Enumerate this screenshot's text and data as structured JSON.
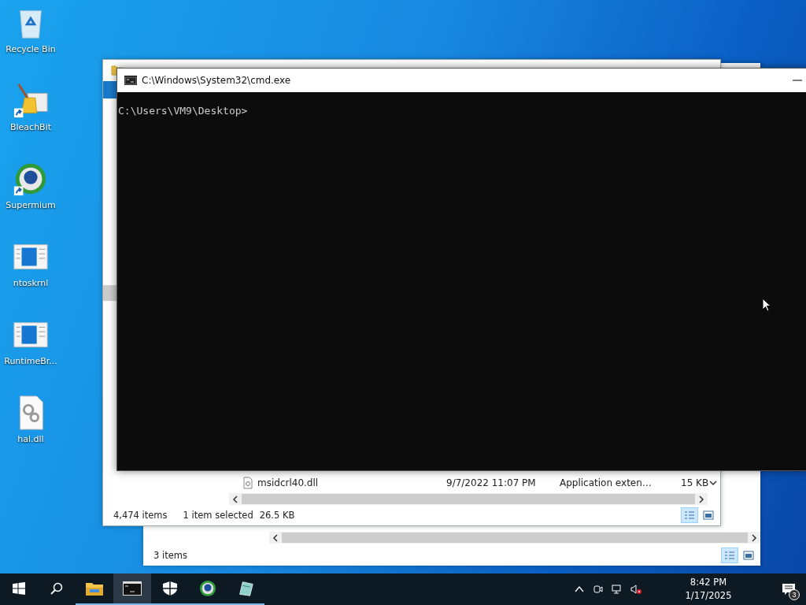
{
  "desktop_icons": [
    {
      "label": "Recycle Bin",
      "kind": "recycle",
      "shortcut": false
    },
    {
      "label": "BleachBit",
      "kind": "broom",
      "shortcut": true
    },
    {
      "label": "Supermium",
      "kind": "browser",
      "shortcut": true
    },
    {
      "label": "ntoskrnl",
      "kind": "window",
      "shortcut": false
    },
    {
      "label": "RuntimeBr...",
      "kind": "window",
      "shortcut": false
    },
    {
      "label": "hal.dll",
      "kind": "gears",
      "shortcut": false
    }
  ],
  "back_explorer": {
    "status": "3 items",
    "views": [
      {
        "kind": "details",
        "selected": true
      },
      {
        "kind": "preview",
        "selected": false
      }
    ]
  },
  "front_explorer": {
    "files": [
      {
        "name": "msidcrl40.dll",
        "date": "9/7/2022 11:07 PM",
        "type": "Application exten…",
        "size": "15 KB"
      }
    ],
    "status": {
      "count": "4,474 items",
      "selection": "1 item selected",
      "size": "26.5 KB"
    },
    "views": [
      {
        "kind": "details",
        "selected": true
      },
      {
        "kind": "preview",
        "selected": false
      }
    ]
  },
  "cmd": {
    "title": "C:\\Windows\\System32\\cmd.exe",
    "lines": [
      "C:\\Users\\VM9\\Desktop>"
    ]
  },
  "taskbar": {
    "apps": [
      {
        "kind": "explorer",
        "open": true,
        "active": false
      },
      {
        "kind": "cmd",
        "open": true,
        "active": true
      },
      {
        "kind": "shield",
        "open": true,
        "active": false
      },
      {
        "kind": "browser",
        "open": true,
        "active": false
      },
      {
        "kind": "bleach",
        "open": true,
        "active": false
      }
    ],
    "clock": {
      "time": "8:42 PM",
      "date": "1/17/2025"
    },
    "notifications": "3"
  }
}
